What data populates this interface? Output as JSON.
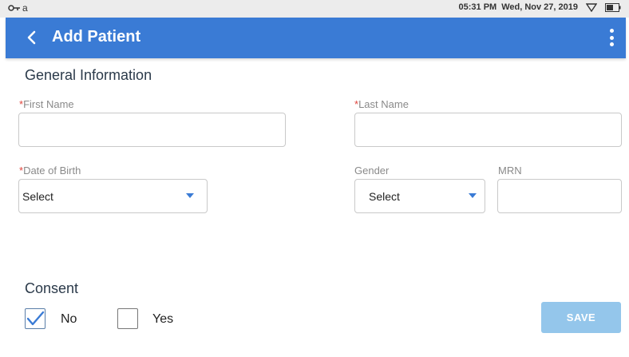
{
  "status_bar": {
    "left_text": "a",
    "time": "05:31 PM",
    "date": "Wed, Nov 27, 2019",
    "icons": [
      "key-icon",
      "wifi-icon",
      "battery-icon"
    ]
  },
  "app_bar": {
    "title": "Add Patient",
    "back_icon": "chevron-left-icon",
    "menu_icon": "more-vertical-icon",
    "color": "#3a7bd5"
  },
  "general": {
    "title": "General Information",
    "required_marker": "*",
    "first_name": {
      "label": "First Name",
      "value": "",
      "required": true
    },
    "last_name": {
      "label": "Last Name",
      "value": "",
      "required": true
    },
    "dob": {
      "label": "Date of Birth",
      "value": "Select",
      "required": true
    },
    "gender": {
      "label": "Gender",
      "value": "Select",
      "required": false
    },
    "mrn": {
      "label": "MRN",
      "value": "",
      "required": false
    }
  },
  "consent": {
    "title": "Consent",
    "options": [
      {
        "label": "No",
        "checked": true
      },
      {
        "label": "Yes",
        "checked": false
      }
    ]
  },
  "save_label": "SAVE",
  "colors": {
    "accent": "#3a7bd5",
    "required": "#e0453d",
    "save_disabled": "#94c6eb"
  }
}
